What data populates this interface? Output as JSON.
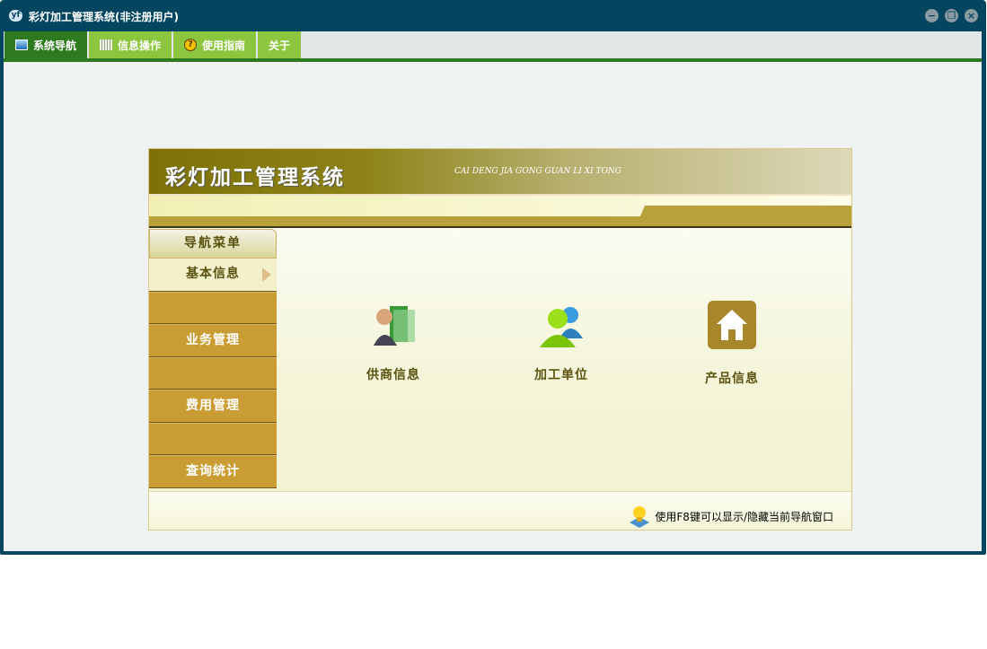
{
  "window": {
    "title": "彩灯加工管理系统(非注册用户)",
    "app_icon": "yf"
  },
  "tabs": [
    {
      "label": "系统导航",
      "icon": "monitor-icon"
    },
    {
      "label": "信息操作",
      "icon": "grid-icon"
    },
    {
      "label": "使用指南",
      "icon": "help-icon"
    },
    {
      "label": "关于"
    }
  ],
  "header": {
    "title": "彩灯加工管理系统",
    "subtitle": "CAI DENG JIA GONG GUAN LI XI TONG"
  },
  "sidebar": {
    "title": "导航菜单",
    "items": [
      {
        "label": "基本信息"
      },
      {
        "label": ""
      },
      {
        "label": "业务管理"
      },
      {
        "label": ""
      },
      {
        "label": "费用管理"
      },
      {
        "label": ""
      },
      {
        "label": "查询统计"
      }
    ]
  },
  "cards": [
    {
      "label": "供商信息",
      "icon": "supplier-icon"
    },
    {
      "label": "加工单位",
      "icon": "users-icon"
    },
    {
      "label": "产品信息",
      "icon": "home-icon"
    }
  ],
  "footer": {
    "tip": "使用F8键可以显示/隐藏当前导航窗口"
  },
  "colors": {
    "titlebar": "#04465f",
    "tab_active": "#2e7a1e",
    "tab": "#8cc63f",
    "menu": "#c99d33"
  }
}
